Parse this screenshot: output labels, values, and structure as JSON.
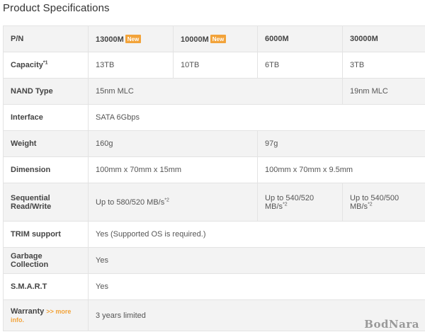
{
  "title": "Product Specifications",
  "new_badge": "New",
  "more_link": ">> more",
  "more_link_2": "info.",
  "watermark": "BodNara",
  "header": {
    "label": "P/N",
    "models": [
      "13000M",
      "10000M",
      "6000M",
      "30000M"
    ]
  },
  "rows": {
    "capacity": {
      "label": "Capacity",
      "sup": "*1",
      "values": [
        "13TB",
        "10TB",
        "6TB",
        "3TB"
      ]
    },
    "nand": {
      "label": "NAND Type",
      "value_a": "15nm MLC",
      "value_b": "19nm MLC"
    },
    "interface": {
      "label": "Interface",
      "value": "SATA 6Gbps"
    },
    "weight": {
      "label": "Weight",
      "value_a": "160g",
      "value_b": "97g"
    },
    "dimension": {
      "label": "Dimension",
      "value_a": "100mm x 70mm x 15mm",
      "value_b": "100mm x 70mm x 9.5mm"
    },
    "seq": {
      "label_1": "Sequential",
      "label_2": "Read/Write",
      "value_a": "Up to 580/520 MB/s",
      "value_b_1": "Up to 540/520",
      "value_b_2": "MB/s",
      "value_c_1": "Up to 540/500",
      "value_c_2": "MB/s",
      "sup": "*2"
    },
    "trim": {
      "label": "TRIM support",
      "value": "Yes (Supported OS is required.)"
    },
    "gc": {
      "label": "Garbage Collection",
      "value": "Yes"
    },
    "smart": {
      "label": "S.M.A.R.T",
      "value": "Yes"
    },
    "warranty": {
      "label": "Warranty",
      "value": "3 years limited"
    }
  },
  "colors": {
    "accent": "#f2a33a",
    "row_alt": "#f3f3f3",
    "border": "#e3e3e3"
  }
}
